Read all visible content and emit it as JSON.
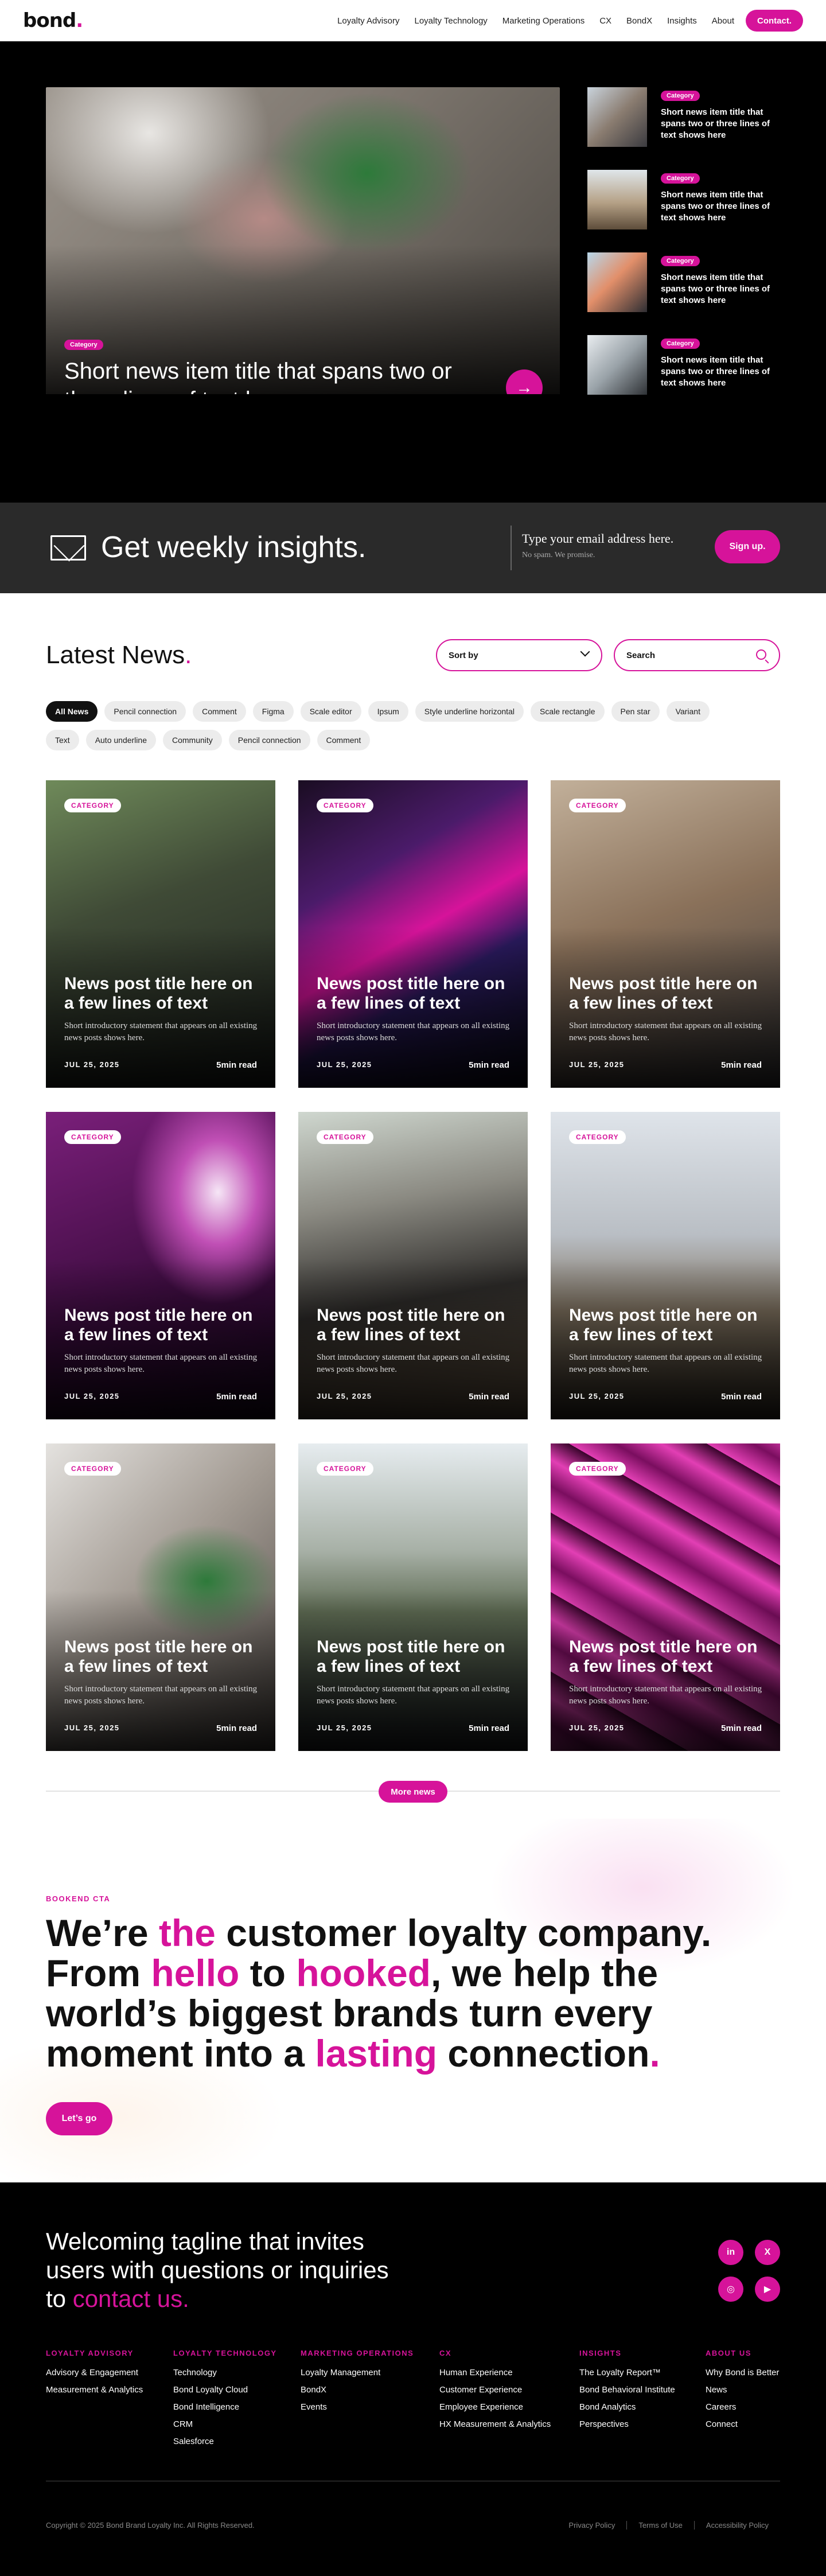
{
  "nav": {
    "logo": "bond",
    "logo_dot": ".",
    "links": [
      "Loyalty Advisory",
      "Loyalty Technology",
      "Marketing Operations",
      "CX",
      "BondX",
      "Insights",
      "About"
    ],
    "cta": "Contact."
  },
  "hero": {
    "main": {
      "category": "Category",
      "title": "Short news item title that spans two or three lines of text here",
      "arrow_icon": "arrow-right-icon"
    },
    "side_items": [
      {
        "category": "Category",
        "title": "Short news item title that spans two or three lines of text shows here"
      },
      {
        "category": "Category",
        "title": "Short news item title that spans two or three lines of text shows here"
      },
      {
        "category": "Category",
        "title": "Short news item title that spans two or three lines of text shows here"
      },
      {
        "category": "Category",
        "title": "Short news item title that spans two or three lines of text shows here"
      }
    ]
  },
  "newsletter": {
    "icon": "envelope-icon",
    "title": "Get weekly insights.",
    "placeholder": "Type your email address here.",
    "hint": "No spam. We promise.",
    "button": "Sign up."
  },
  "latest": {
    "title": "Latest News",
    "title_dot": ".",
    "sort_label": "Sort by",
    "search_placeholder": "Search",
    "tags": [
      "All News",
      "Pencil connection",
      "Comment",
      "Figma",
      "Scale editor",
      "Ipsum",
      "Style underline horizontal",
      "Scale rectangle",
      "Pen star",
      "Variant",
      "Text",
      "Auto underline",
      "Community",
      "Pencil connection",
      "Comment"
    ],
    "cards": [
      {
        "category": "CATEGORY",
        "title": "News post title here on a few lines of text",
        "desc": "Short introductory statement that appears on all existing news posts shows here.",
        "date": "JUL 25, 2025",
        "read": "5min read"
      },
      {
        "category": "CATEGORY",
        "title": "News post title here on a few lines of text",
        "desc": "Short introductory statement that appears on all existing news posts shows here.",
        "date": "JUL 25, 2025",
        "read": "5min read"
      },
      {
        "category": "CATEGORY",
        "title": "News post title here on a few lines of text",
        "desc": "Short introductory statement that appears on all existing news posts shows here.",
        "date": "JUL 25, 2025",
        "read": "5min read"
      },
      {
        "category": "CATEGORY",
        "title": "News post title here on a few lines of text",
        "desc": "Short introductory statement that appears on all existing news posts shows here.",
        "date": "JUL 25, 2025",
        "read": "5min read"
      },
      {
        "category": "CATEGORY",
        "title": "News post title here on a few lines of text",
        "desc": "Short introductory statement that appears on all existing news posts shows here.",
        "date": "JUL 25, 2025",
        "read": "5min read"
      },
      {
        "category": "CATEGORY",
        "title": "News post title here on a few lines of text",
        "desc": "Short introductory statement that appears on all existing news posts shows here.",
        "date": "JUL 25, 2025",
        "read": "5min read"
      },
      {
        "category": "CATEGORY",
        "title": "News post title here on a few lines of text",
        "desc": "Short introductory statement that appears on all existing news posts shows here.",
        "date": "JUL 25, 2025",
        "read": "5min read"
      },
      {
        "category": "CATEGORY",
        "title": "News post title here on a few lines of text",
        "desc": "Short introductory statement that appears on all existing news posts shows here.",
        "date": "JUL 25, 2025",
        "read": "5min read"
      },
      {
        "category": "CATEGORY",
        "title": "News post title here on a few lines of text",
        "desc": "Short introductory statement that appears on all existing news posts shows here.",
        "date": "JUL 25, 2025",
        "read": "5min read"
      }
    ],
    "more_button": "More news"
  },
  "cta": {
    "eyebrow": "BOOKEND CTA",
    "line1_a": "We’re ",
    "line1_hl": "the",
    "line1_b": " customer loyalty company.",
    "line2_a": "From ",
    "line2_hl1": "hello",
    "line2_b": " to ",
    "line2_hl2": "hooked",
    "line2_c": ", we help the",
    "line3": "world’s biggest brands turn every",
    "line4_a": "moment into a ",
    "line4_hl": "lasting",
    "line4_b": " connection",
    "line4_dot": ".",
    "button": "Let’s go"
  },
  "footer": {
    "tagline_a": "Welcoming tagline that invites users with questions or inquiries to ",
    "tagline_link": "contact us.",
    "social": [
      {
        "icon": "linkedin-icon",
        "glyph": "in"
      },
      {
        "icon": "x-icon",
        "glyph": "X"
      },
      {
        "icon": "instagram-icon",
        "glyph": "◎"
      },
      {
        "icon": "youtube-icon",
        "glyph": "▶"
      }
    ],
    "columns": [
      {
        "heading": "LOYALTY ADVISORY",
        "links": [
          "Advisory & Engagement",
          "Measurement & Analytics"
        ]
      },
      {
        "heading": "LOYALTY TECHNOLOGY",
        "links": [
          "Technology",
          "Bond Loyalty Cloud",
          "Bond Intelligence",
          "CRM",
          "Salesforce"
        ]
      },
      {
        "heading": "MARKETING OPERATIONS",
        "links": [
          "Loyalty Management",
          "BondX",
          "Events"
        ]
      },
      {
        "heading": "CX",
        "links": [
          "Human Experience",
          "Customer Experience",
          "Employee Experience",
          "HX Measurement & Analytics"
        ]
      },
      {
        "heading": "INSIGHTS",
        "links": [
          "The Loyalty Report™",
          "Bond Behavioral Institute",
          "Bond Analytics",
          "Perspectives"
        ]
      },
      {
        "heading": "ABOUT US",
        "links": [
          "Why Bond is Better",
          "News",
          "Careers",
          "Connect"
        ]
      }
    ],
    "copyright": "Copyright © 2025 Bond Brand Loyalty Inc. All Rights Reserved.",
    "legal": [
      "Privacy Policy",
      "Terms of Use",
      "Accessibility Policy"
    ]
  },
  "colors": {
    "accent": "#d6139a",
    "dark": "#000000",
    "newsletter_bg": "#2a2a2a"
  }
}
